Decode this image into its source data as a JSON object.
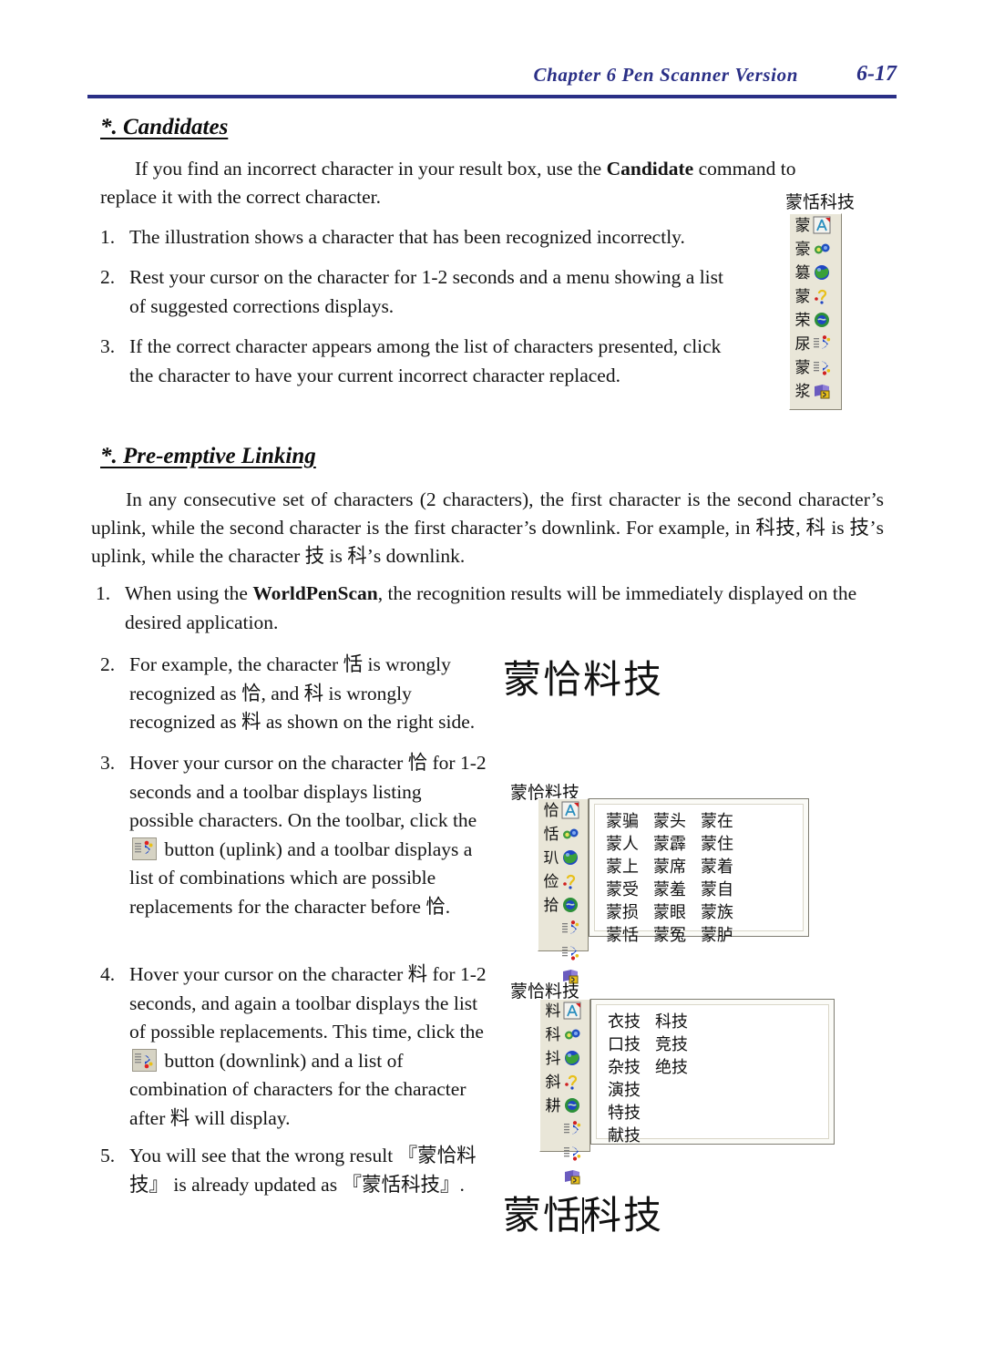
{
  "header": {
    "chapter_title": "Chapter 6  Pen Scanner  Version",
    "page_number": "6-17",
    "color": "#2a2f86"
  },
  "sections": {
    "candidates": {
      "heading": "*. Candidates",
      "intro_lead": "If you find an incorrect character in your result box, use the ",
      "intro_bold": "Candidate",
      "intro_tail": " command to replace it with the correct character.",
      "items": [
        {
          "num": "1.",
          "text": "The illustration shows a character that has been recognized incorrectly."
        },
        {
          "num": "2.",
          "text": "Rest your cursor on the character for 1-2 seconds and a menu showing a list of suggested corrections displays."
        },
        {
          "num": "3.",
          "text": "If the correct character appears among the list of characters presented, click the character to have your current incorrect character replaced."
        }
      ]
    },
    "preemptive": {
      "heading": "*. Pre-emptive Linking",
      "intro": "In any consecutive set of characters (2 characters), the first character is the second character’s uplink, while the second character is the first character’s downlink. For example, in 科技, 科 is 技’s uplink, while the character 技 is 科’s downlink.",
      "item1": {
        "num": "1.",
        "lead": "When using the ",
        "bold": "WorldPenScan",
        "tail": ", the recognition results will be immediately displayed on the desired application."
      },
      "item2": {
        "num": "2.",
        "text": "For example, the character 恬 is wrongly recognized as 恰, and 科 is wrongly recognized as 料 as shown on the right side."
      },
      "item3": {
        "num": "3.",
        "part1": "Hover your cursor on the character 恰 for 1-2 seconds and a toolbar displays listing possible characters. On the toolbar, click the ",
        "icon": "uplink-button-icon",
        "part2": " button (uplink) and a toolbar displays a list of combinations which are possible replacements for the character before 恰."
      },
      "item4": {
        "num": "4.",
        "part1": "Hover your cursor on the character 料 for 1-2 seconds, and again a toolbar displays the list of possible replacements. This time, click the ",
        "icon": "downlink-button-icon",
        "part2": " button (downlink) and a list of combination of characters for the character after 料 will display."
      },
      "item5": {
        "num": "5.",
        "text": "You will see that the wrong result 『蒙恰料技』 is already updated as 『蒙恬科技』."
      }
    }
  },
  "figures": {
    "candidates_toolbar": {
      "title": "蒙恬科技",
      "rows": [
        {
          "char": "蒙",
          "icon": "letter-a-icon"
        },
        {
          "char": "豪",
          "icon": "globe-small-icon"
        },
        {
          "char": "篡",
          "icon": "globe-icon"
        },
        {
          "char": "蒙",
          "icon": "question-mark-icon"
        },
        {
          "char": "荣",
          "icon": "globe-green-icon"
        },
        {
          "char": "尿",
          "icon": "uplink-icon"
        },
        {
          "char": "蒙",
          "icon": "downlink-icon"
        },
        {
          "char": "浆",
          "icon": "book-icon"
        }
      ]
    },
    "wrong_result_text": "蒙恰料技",
    "uplink_toolbar": {
      "title": "蒙恰料技",
      "chars": [
        "恰",
        "恬",
        "玐",
        "俭",
        "拾"
      ],
      "icons": [
        "letter-a-icon",
        "globe-small-icon",
        "globe-icon",
        "question-mark-icon",
        "globe-green-icon",
        "uplink-icon",
        "downlink-icon",
        "book-icon"
      ],
      "words": [
        [
          "蒙骗",
          "蒙头",
          "蒙在"
        ],
        [
          "蒙人",
          "蒙霹",
          "蒙住"
        ],
        [
          "蒙上",
          "蒙席",
          "蒙着"
        ],
        [
          "蒙受",
          "蒙羞",
          "蒙自"
        ],
        [
          "蒙损",
          "蒙眼",
          "蒙族"
        ],
        [
          "蒙恬",
          "蒙冤",
          "蒙胪"
        ]
      ],
      "selected": {
        "row": 5,
        "col": 0
      }
    },
    "downlink_toolbar": {
      "title": "蒙恰料技",
      "chars": [
        "料",
        "科",
        "抖",
        "斜",
        "耕"
      ],
      "icons": [
        "letter-a-icon",
        "globe-small-icon",
        "globe-icon",
        "question-mark-icon",
        "globe-green-icon",
        "uplink-icon",
        "downlink-icon",
        "book-icon"
      ],
      "words": [
        [
          "衣技",
          "科技"
        ],
        [
          "口技",
          "竞技"
        ],
        [
          "杂技",
          "绝技"
        ],
        [
          "演技",
          ""
        ],
        [
          "特技",
          ""
        ],
        [
          "献技",
          ""
        ]
      ],
      "selected": {
        "row": 0,
        "col": 1
      }
    },
    "corrected_result": {
      "before_caret": "蒙恬",
      "after_caret": "科技"
    }
  },
  "colors": {
    "header_navy": "#2a2f86",
    "toolbar_bg": "#e9e6d8",
    "selection_blue": "#0a24c8"
  }
}
